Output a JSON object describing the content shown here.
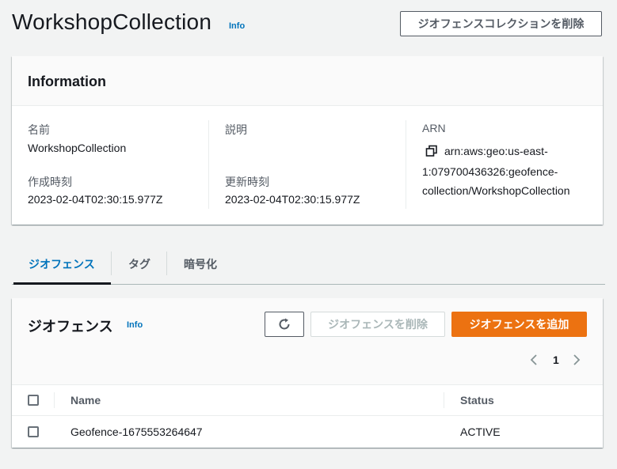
{
  "header": {
    "title": "WorkshopCollection",
    "info": "Info",
    "delete_button": "ジオフェンスコレクションを削除"
  },
  "information": {
    "title": "Information",
    "name_label": "名前",
    "name_value": "WorkshopCollection",
    "description_label": "説明",
    "description_value": "",
    "arn_label": "ARN",
    "arn_line1": "arn:aws:geo:us-east-",
    "arn_line2": "1:079700436326:geofence-",
    "arn_line3": "collection/WorkshopCollection",
    "created_label": "作成時刻",
    "created_value": "2023-02-04T02:30:15.977Z",
    "updated_label": "更新時刻",
    "updated_value": "2023-02-04T02:30:15.977Z"
  },
  "tabs": [
    {
      "label": "ジオフェンス",
      "active": true
    },
    {
      "label": "タグ",
      "active": false
    },
    {
      "label": "暗号化",
      "active": false
    }
  ],
  "geofences": {
    "title": "ジオフェンス",
    "info": "Info",
    "delete_button": "ジオフェンスを削除",
    "add_button": "ジオフェンスを追加",
    "page": "1",
    "columns": {
      "name": "Name",
      "status": "Status"
    },
    "rows": [
      {
        "name": "Geofence-1675553264647",
        "status": "ACTIVE"
      }
    ]
  },
  "colors": {
    "accent": "#0073bb",
    "primary_button": "#ec7211",
    "background": "#f2f3f3"
  }
}
